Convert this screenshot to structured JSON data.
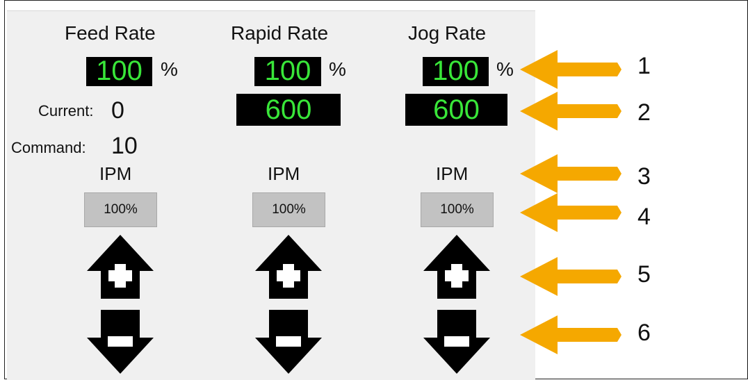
{
  "columns": [
    {
      "title": "Feed Rate",
      "override_value": "100",
      "percent_symbol": "%",
      "unit": "IPM",
      "percent_button": "100%"
    },
    {
      "title": "Rapid Rate",
      "override_value": "100",
      "percent_symbol": "%",
      "rate_value": "600",
      "unit": "IPM",
      "percent_button": "100%"
    },
    {
      "title": "Jog Rate",
      "override_value": "100",
      "percent_symbol": "%",
      "rate_value": "600",
      "unit": "IPM",
      "percent_button": "100%"
    }
  ],
  "feed": {
    "current_label": "Current:",
    "current_value": "0",
    "command_label": "Command:",
    "command_value": "10"
  },
  "callouts": [
    "1",
    "2",
    "3",
    "4",
    "5",
    "6"
  ],
  "colors": {
    "display_bg": "#000000",
    "display_text": "#39e639",
    "callout_arrow": "#f5a800",
    "button_bg": "#c2c2c2",
    "panel_bg": "#f0f0f0"
  }
}
